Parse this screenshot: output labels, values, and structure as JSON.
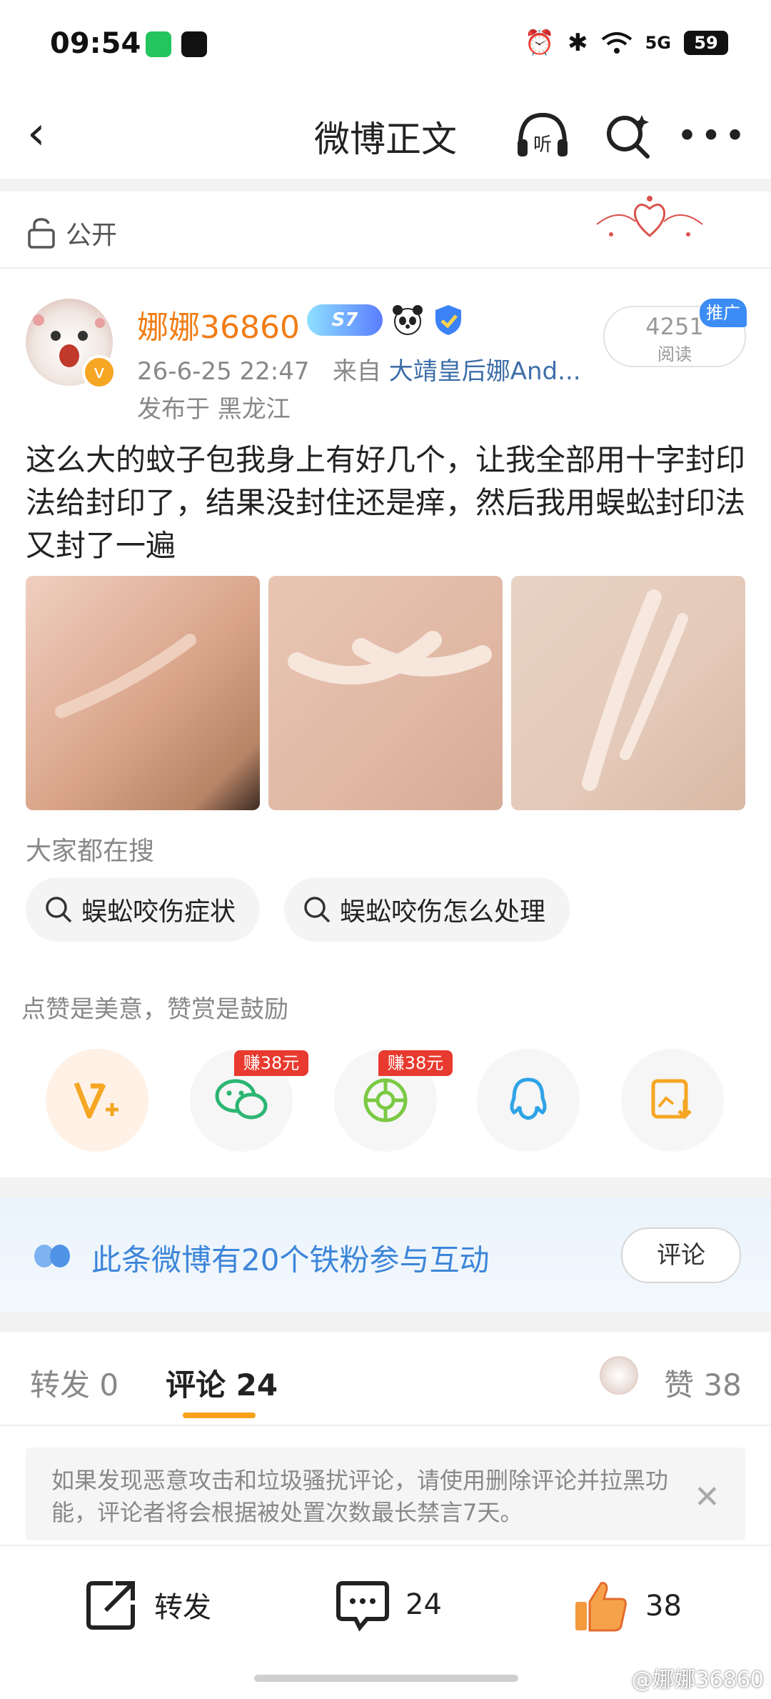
{
  "status_bar": {
    "time": "09:54",
    "battery": "59",
    "network": "5G"
  },
  "nav": {
    "title": "微博正文"
  },
  "visibility": {
    "label": "公开"
  },
  "post": {
    "username": "娜娜36860",
    "level_badge": "S7",
    "timestamp": "26-6-25 22:47",
    "source_prefix": "来自",
    "source": "大靖皇后娜And...",
    "location": "发布于 黑龙江",
    "read_count": "4251",
    "read_label": "阅读",
    "promo_tag": "推广",
    "text": "这么大的蚊子包我身上有好几个，让我全部用十字封印法给封印了，结果没封住还是痒，然后我用蜈蚣封印法又封了一遍",
    "images": [
      "scratch-mark-photo-1",
      "scratch-mark-photo-2",
      "scratch-mark-photo-3"
    ]
  },
  "search": {
    "label": "大家都在搜",
    "chips": [
      "蜈蚣咬伤症状",
      "蜈蚣咬伤怎么处理"
    ]
  },
  "share": {
    "tip": "点赞是美意，赞赏是鼓励",
    "wechat_tag": "赚38元",
    "moments_tag": "赚38元"
  },
  "fans_banner": {
    "text": "此条微博有20个铁粉参与互动",
    "button": "评论"
  },
  "tabs": {
    "repost": "转发 0",
    "comment": "评论 24",
    "like": "赞 38"
  },
  "notice": {
    "text": "如果发现恶意攻击和垃圾骚扰评论，请使用删除评论并拉黑功能，评论者将会根据被处置次数最长禁言7天。"
  },
  "bottom_bar": {
    "repost_label": "转发",
    "comment_count": "24",
    "like_count": "38"
  },
  "watermark": "@娜娜36860",
  "colors": {
    "accent": "#f07d16",
    "link": "#3d6ea8",
    "blue_text": "#3d86d9",
    "tag_red": "#e83a2e"
  }
}
